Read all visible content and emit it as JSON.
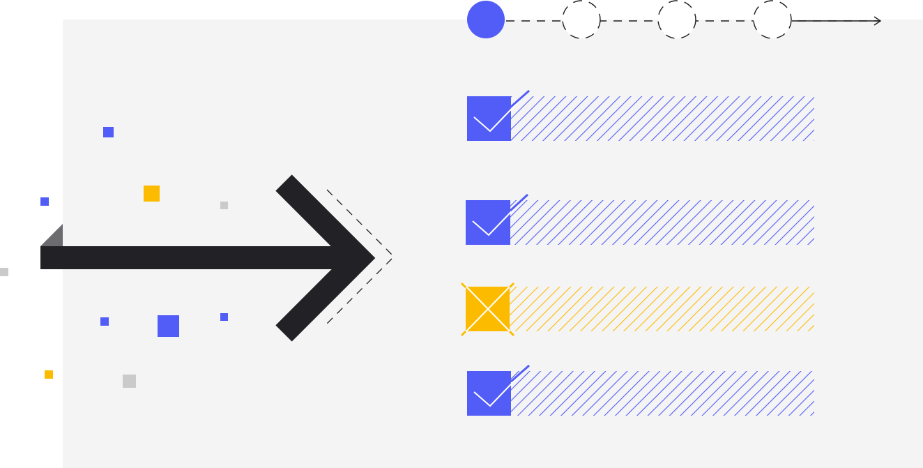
{
  "colors": {
    "background": "#ffffff",
    "panel": "#f4f4f5",
    "accent_blue": "#525cf7",
    "accent_yellow": "#fdbb00",
    "dark": "#222226",
    "arrow_fold": "#6b6b70",
    "confetti_gray": "#cacaca",
    "stroke": "#1c1c1e"
  },
  "progress_track": {
    "step_count": 4,
    "completed_steps": 1
  },
  "checklist": {
    "items": [
      {
        "status": "checked",
        "color": "accent_blue",
        "icon": "checkmark-icon"
      },
      {
        "status": "checked",
        "color": "accent_blue",
        "icon": "checkmark-icon"
      },
      {
        "status": "failed",
        "color": "accent_yellow",
        "icon": "cross-icon"
      },
      {
        "status": "checked",
        "color": "accent_blue",
        "icon": "checkmark-icon"
      }
    ]
  },
  "main_arrow": {
    "icon": "arrow-right-icon",
    "direction": "right"
  }
}
